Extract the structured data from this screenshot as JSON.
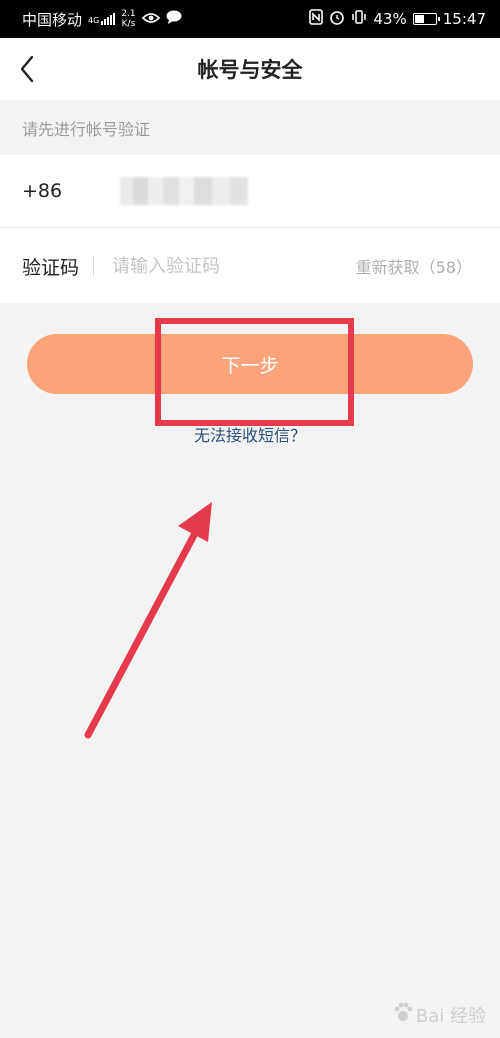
{
  "status_bar": {
    "carrier": "中国移动",
    "network": "4G",
    "speed_value": "2.1",
    "speed_unit": "K/s",
    "battery": "43%",
    "time": "15:47"
  },
  "nav": {
    "title": "帐号与安全"
  },
  "hint": "请先进行帐号验证",
  "phone": {
    "country_code": "+86"
  },
  "code": {
    "label": "验证码",
    "placeholder": "请输入验证码",
    "resend": "重新获取（58）"
  },
  "next_button": "下一步",
  "sms_link": "无法接收短信？",
  "watermark": {
    "text": "Bai 经验"
  },
  "colors": {
    "accent": "#fba47a",
    "annotation": "#e53a4b",
    "link": "#2b4f7c"
  },
  "icons": [
    "back-icon",
    "eye-icon",
    "chat-icon",
    "nfc-icon",
    "alarm-icon",
    "vibrate-icon",
    "battery-icon",
    "signal-icon",
    "paw-icon"
  ]
}
